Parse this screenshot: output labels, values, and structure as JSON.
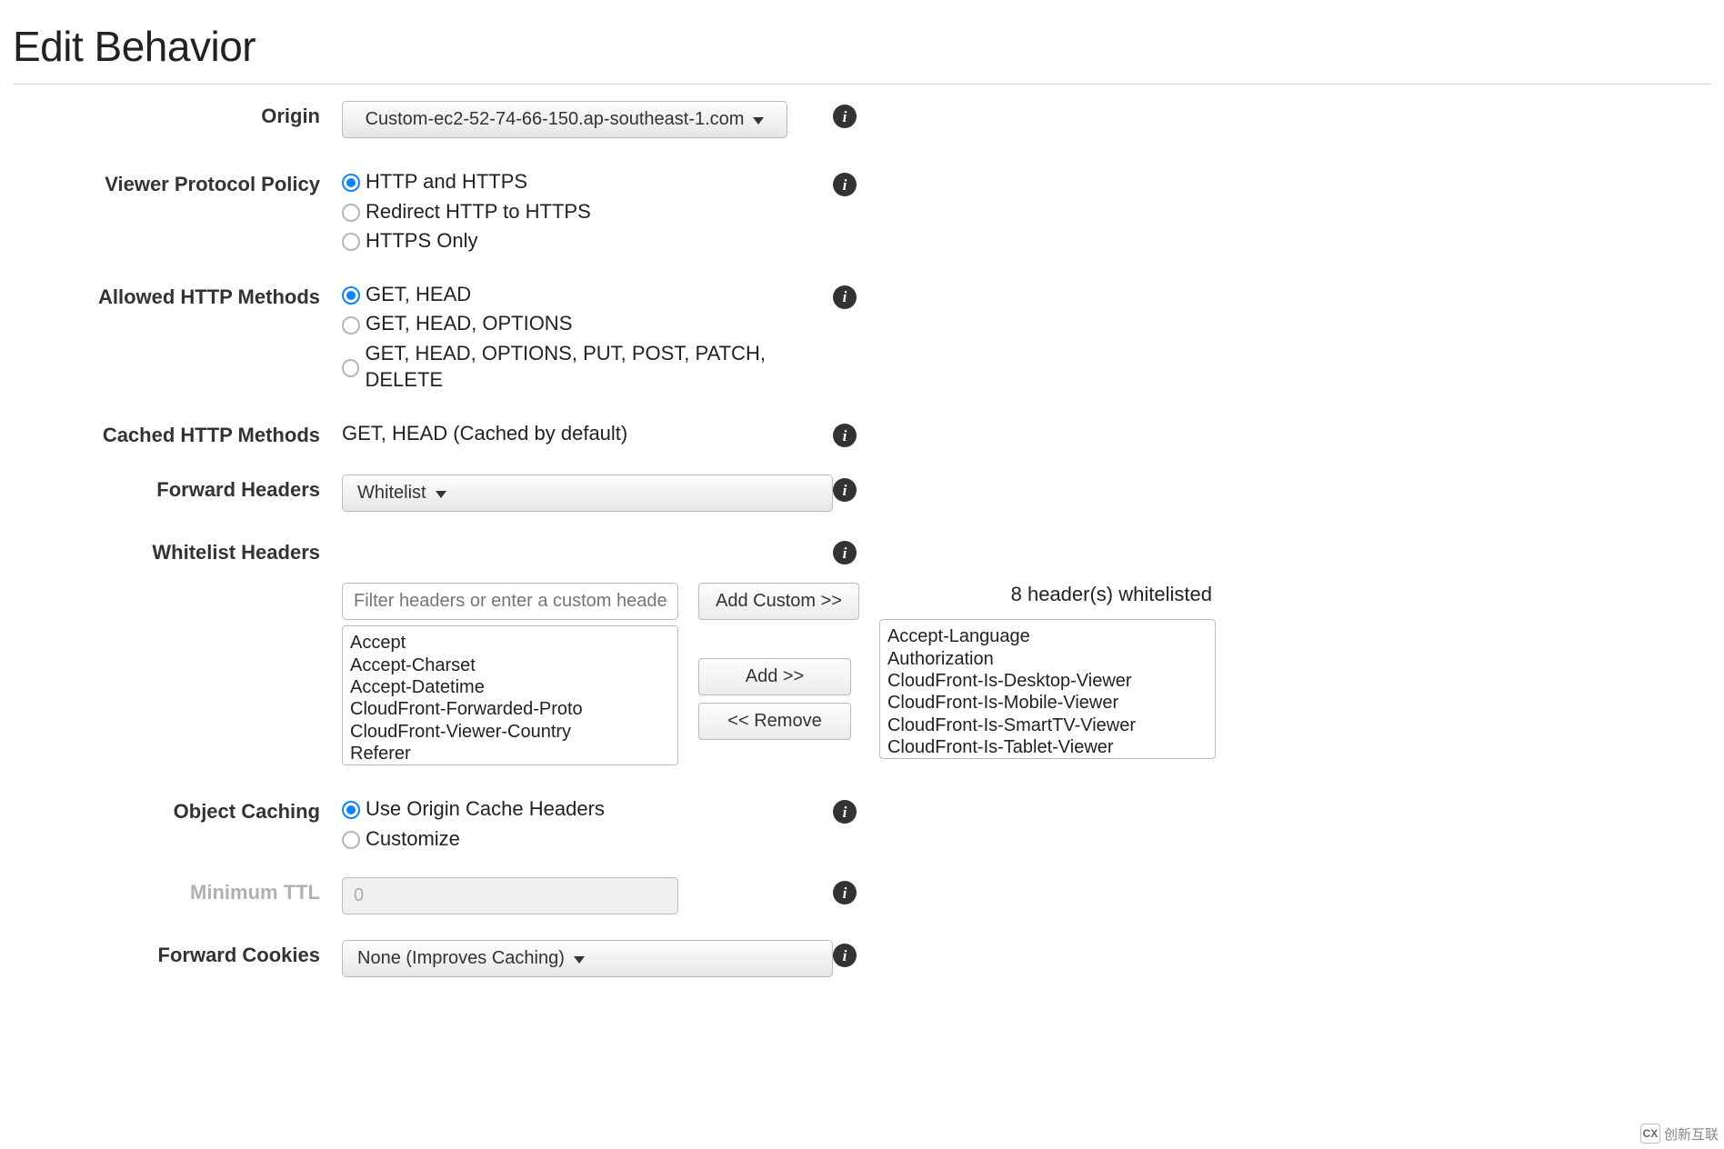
{
  "page_title": "Edit Behavior",
  "rows": {
    "origin": {
      "label": "Origin",
      "value": "Custom-ec2-52-74-66-150.ap-southeast-1.com"
    },
    "viewer_protocol_policy": {
      "label": "Viewer Protocol Policy",
      "options": [
        "HTTP and HTTPS",
        "Redirect HTTP to HTTPS",
        "HTTPS Only"
      ],
      "selected_index": 0
    },
    "allowed_http_methods": {
      "label": "Allowed HTTP Methods",
      "options": [
        "GET, HEAD",
        "GET, HEAD, OPTIONS",
        "GET, HEAD, OPTIONS, PUT, POST, PATCH, DELETE"
      ],
      "selected_index": 0
    },
    "cached_http_methods": {
      "label": "Cached HTTP Methods",
      "value": "GET, HEAD (Cached by default)"
    },
    "forward_headers": {
      "label": "Forward Headers",
      "value": "Whitelist"
    },
    "whitelist_headers": {
      "label": "Whitelist Headers",
      "filter_placeholder": "Filter headers or enter a custom header",
      "add_custom_label": "Add Custom >>",
      "add_label": "Add >>",
      "remove_label": "<< Remove",
      "available": [
        "Accept",
        "Accept-Charset",
        "Accept-Datetime",
        "CloudFront-Forwarded-Proto",
        "CloudFront-Viewer-Country",
        "Referer"
      ],
      "whitelisted": [
        "Accept-Language",
        "Authorization",
        "CloudFront-Is-Desktop-Viewer",
        "CloudFront-Is-Mobile-Viewer",
        "CloudFront-Is-SmartTV-Viewer",
        "CloudFront-Is-Tablet-Viewer"
      ],
      "count_text": "8 header(s) whitelisted"
    },
    "object_caching": {
      "label": "Object Caching",
      "options": [
        "Use Origin Cache Headers",
        "Customize"
      ],
      "selected_index": 0
    },
    "minimum_ttl": {
      "label": "Minimum TTL",
      "value": "0"
    },
    "forward_cookies": {
      "label": "Forward Cookies",
      "value": "None (Improves Caching)"
    }
  },
  "watermark": "创新互联"
}
